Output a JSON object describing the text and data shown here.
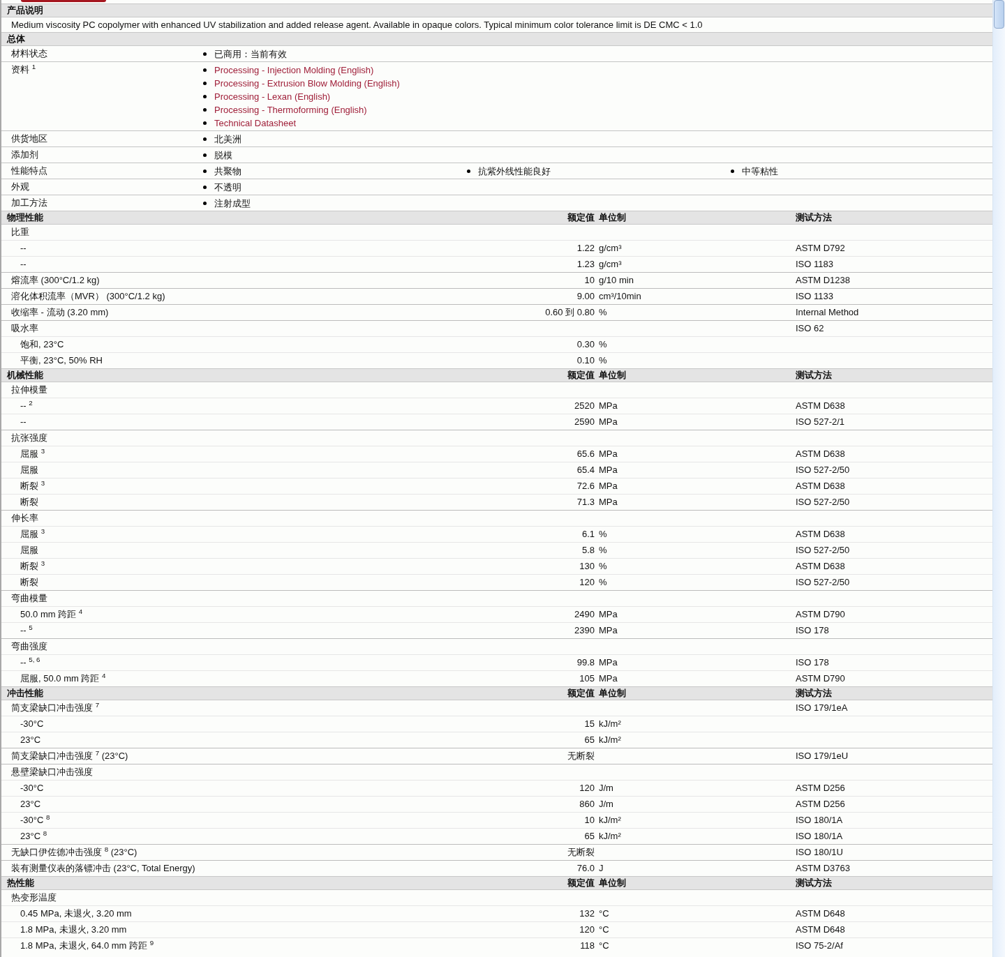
{
  "description": {
    "title": "产品说明",
    "text": "Medium viscosity PC copolymer with enhanced UV stabilization and added release agent. Available in opaque colors. Typical minimum color tolerance limit is DE CMC < 1.0"
  },
  "general": {
    "title": "总体",
    "rows": [
      {
        "label": "材料状态",
        "kind": "stacked",
        "items": [
          {
            "text": "已商用：当前有效",
            "link": false
          }
        ]
      },
      {
        "label": "资料 $^{1}$",
        "kind": "stacked",
        "items": [
          {
            "text": "Processing - Injection Molding (English)",
            "link": true
          },
          {
            "text": "Processing - Extrusion Blow Molding (English)",
            "link": true
          },
          {
            "text": "Processing - Lexan (English)",
            "link": true
          },
          {
            "text": "Processing - Thermoforming (English)",
            "link": true
          },
          {
            "text": "Technical Datasheet",
            "link": true
          }
        ]
      },
      {
        "label": "供货地区",
        "kind": "stacked",
        "items": [
          {
            "text": "北美洲",
            "link": false
          }
        ]
      },
      {
        "label": "添加剂",
        "kind": "stacked",
        "items": [
          {
            "text": "脱模",
            "link": false
          }
        ]
      },
      {
        "label": "性能特点",
        "kind": "columns",
        "items": [
          {
            "text": "共聚物",
            "link": false
          },
          {
            "text": "抗紫外线性能良好",
            "link": false
          },
          {
            "text": "中等粘性",
            "link": false
          }
        ]
      },
      {
        "label": "外观",
        "kind": "stacked",
        "items": [
          {
            "text": "不透明",
            "link": false
          }
        ]
      },
      {
        "label": "加工方法",
        "kind": "stacked",
        "items": [
          {
            "text": "注射成型",
            "link": false
          }
        ]
      }
    ]
  },
  "sections": [
    {
      "title": "物理性能",
      "headers": {
        "value": "额定值",
        "unit": "单位制",
        "method": "测试方法"
      },
      "rows": [
        {
          "kind": "main",
          "label": "比重"
        },
        {
          "kind": "sub",
          "label": "--",
          "value": "1.22",
          "unit": "g/cm³",
          "method": "ASTM D792"
        },
        {
          "kind": "sub",
          "label": "--",
          "value": "1.23",
          "unit": "g/cm³",
          "method": "ISO 1183"
        },
        {
          "kind": "main",
          "label": "熔流率 (300°C/1.2 kg)",
          "value": "10",
          "unit": "g/10 min",
          "method": "ASTM D1238"
        },
        {
          "kind": "main",
          "label": "溶化体积流率（MVR） (300°C/1.2 kg)",
          "value": "9.00",
          "unit": "cm³/10min",
          "method": "ISO 1133"
        },
        {
          "kind": "main",
          "label": "收缩率 - 流动 (3.20 mm)",
          "value": "0.60 到 0.80",
          "unit": "%",
          "method": "Internal Method"
        },
        {
          "kind": "main",
          "label": "吸水率",
          "method": "ISO 62"
        },
        {
          "kind": "sub",
          "label": "饱和, 23°C",
          "value": "0.30",
          "unit": "%"
        },
        {
          "kind": "sub",
          "label": "平衡, 23°C, 50% RH",
          "value": "0.10",
          "unit": "%"
        }
      ]
    },
    {
      "title": "机械性能",
      "headers": {
        "value": "额定值",
        "unit": "单位制",
        "method": "测试方法"
      },
      "rows": [
        {
          "kind": "main",
          "label": "拉伸模量"
        },
        {
          "kind": "sub",
          "label": "-- $^{2}$",
          "value": "2520",
          "unit": "MPa",
          "method": "ASTM D638"
        },
        {
          "kind": "sub",
          "label": "--",
          "value": "2590",
          "unit": "MPa",
          "method": "ISO 527-2/1"
        },
        {
          "kind": "main",
          "label": "抗张强度"
        },
        {
          "kind": "sub",
          "label": "屈服 $^{3}$",
          "value": "65.6",
          "unit": "MPa",
          "method": "ASTM D638"
        },
        {
          "kind": "sub",
          "label": "屈服",
          "value": "65.4",
          "unit": "MPa",
          "method": "ISO 527-2/50"
        },
        {
          "kind": "sub",
          "label": "断裂 $^{3}$",
          "value": "72.6",
          "unit": "MPa",
          "method": "ASTM D638"
        },
        {
          "kind": "sub",
          "label": "断裂",
          "value": "71.3",
          "unit": "MPa",
          "method": "ISO 527-2/50"
        },
        {
          "kind": "main",
          "label": "伸长率"
        },
        {
          "kind": "sub",
          "label": "屈服 $^{3}$",
          "value": "6.1",
          "unit": "%",
          "method": "ASTM D638"
        },
        {
          "kind": "sub",
          "label": "屈服",
          "value": "5.8",
          "unit": "%",
          "method": "ISO 527-2/50"
        },
        {
          "kind": "sub",
          "label": "断裂 $^{3}$",
          "value": "130",
          "unit": "%",
          "method": "ASTM D638"
        },
        {
          "kind": "sub",
          "label": "断裂",
          "value": "120",
          "unit": "%",
          "method": "ISO 527-2/50"
        },
        {
          "kind": "main",
          "label": "弯曲模量"
        },
        {
          "kind": "sub",
          "label": "50.0 mm 跨距 $^{4}$",
          "value": "2490",
          "unit": "MPa",
          "method": "ASTM D790"
        },
        {
          "kind": "sub",
          "label": "-- $^{5}$",
          "value": "2390",
          "unit": "MPa",
          "method": "ISO 178"
        },
        {
          "kind": "main",
          "label": "弯曲强度"
        },
        {
          "kind": "sub",
          "label": "-- $^{5, 6}$",
          "value": "99.8",
          "unit": "MPa",
          "method": "ISO 178"
        },
        {
          "kind": "sub",
          "label": "屈服, 50.0 mm 跨距 $^{4}$",
          "value": "105",
          "unit": "MPa",
          "method": "ASTM D790"
        }
      ]
    },
    {
      "title": "冲击性能",
      "headers": {
        "value": "额定值",
        "unit": "单位制",
        "method": "测试方法"
      },
      "rows": [
        {
          "kind": "main",
          "label": "简支梁缺口冲击强度 $^{7}$",
          "method": "ISO 179/1eA"
        },
        {
          "kind": "sub",
          "label": "-30°C",
          "value": "15",
          "unit": "kJ/m²"
        },
        {
          "kind": "sub",
          "label": "23°C",
          "value": "65",
          "unit": "kJ/m²"
        },
        {
          "kind": "main",
          "label": "简支梁缺口冲击强度 $^{7}$ (23°C)",
          "value": "无断裂",
          "method": "ISO 179/1eU"
        },
        {
          "kind": "main",
          "label": "悬壁梁缺口冲击强度"
        },
        {
          "kind": "sub",
          "label": "-30°C",
          "value": "120",
          "unit": "J/m",
          "method": "ASTM D256"
        },
        {
          "kind": "sub",
          "label": "23°C",
          "value": "860",
          "unit": "J/m",
          "method": "ASTM D256"
        },
        {
          "kind": "sub",
          "label": "-30°C $^{8}$",
          "value": "10",
          "unit": "kJ/m²",
          "method": "ISO 180/1A"
        },
        {
          "kind": "sub",
          "label": "23°C $^{8}$",
          "value": "65",
          "unit": "kJ/m²",
          "method": "ISO 180/1A"
        },
        {
          "kind": "main",
          "label": "无缺口伊佐德冲击强度 $^{8}$ (23°C)",
          "value": "无断裂",
          "method": "ISO 180/1U"
        },
        {
          "kind": "main",
          "label": "装有测量仪表的落镖冲击 (23°C, Total Energy)",
          "value": "76.0",
          "unit": "J",
          "method": "ASTM D3763"
        }
      ]
    },
    {
      "title": "热性能",
      "headers": {
        "value": "额定值",
        "unit": "单位制",
        "method": "测试方法"
      },
      "rows": [
        {
          "kind": "main",
          "label": "热变形温度"
        },
        {
          "kind": "sub",
          "label": "0.45 MPa, 未退火, 3.20 mm",
          "value": "132",
          "unit": "°C",
          "method": "ASTM D648"
        },
        {
          "kind": "sub",
          "label": "1.8 MPa, 未退火, 3.20 mm",
          "value": "120",
          "unit": "°C",
          "method": "ASTM D648"
        },
        {
          "kind": "sub",
          "label": "1.8 MPa, 未退火, 64.0 mm 跨距 $^{9}$",
          "value": "118",
          "unit": "°C",
          "method": "ISO 75-2/Af"
        }
      ]
    }
  ]
}
